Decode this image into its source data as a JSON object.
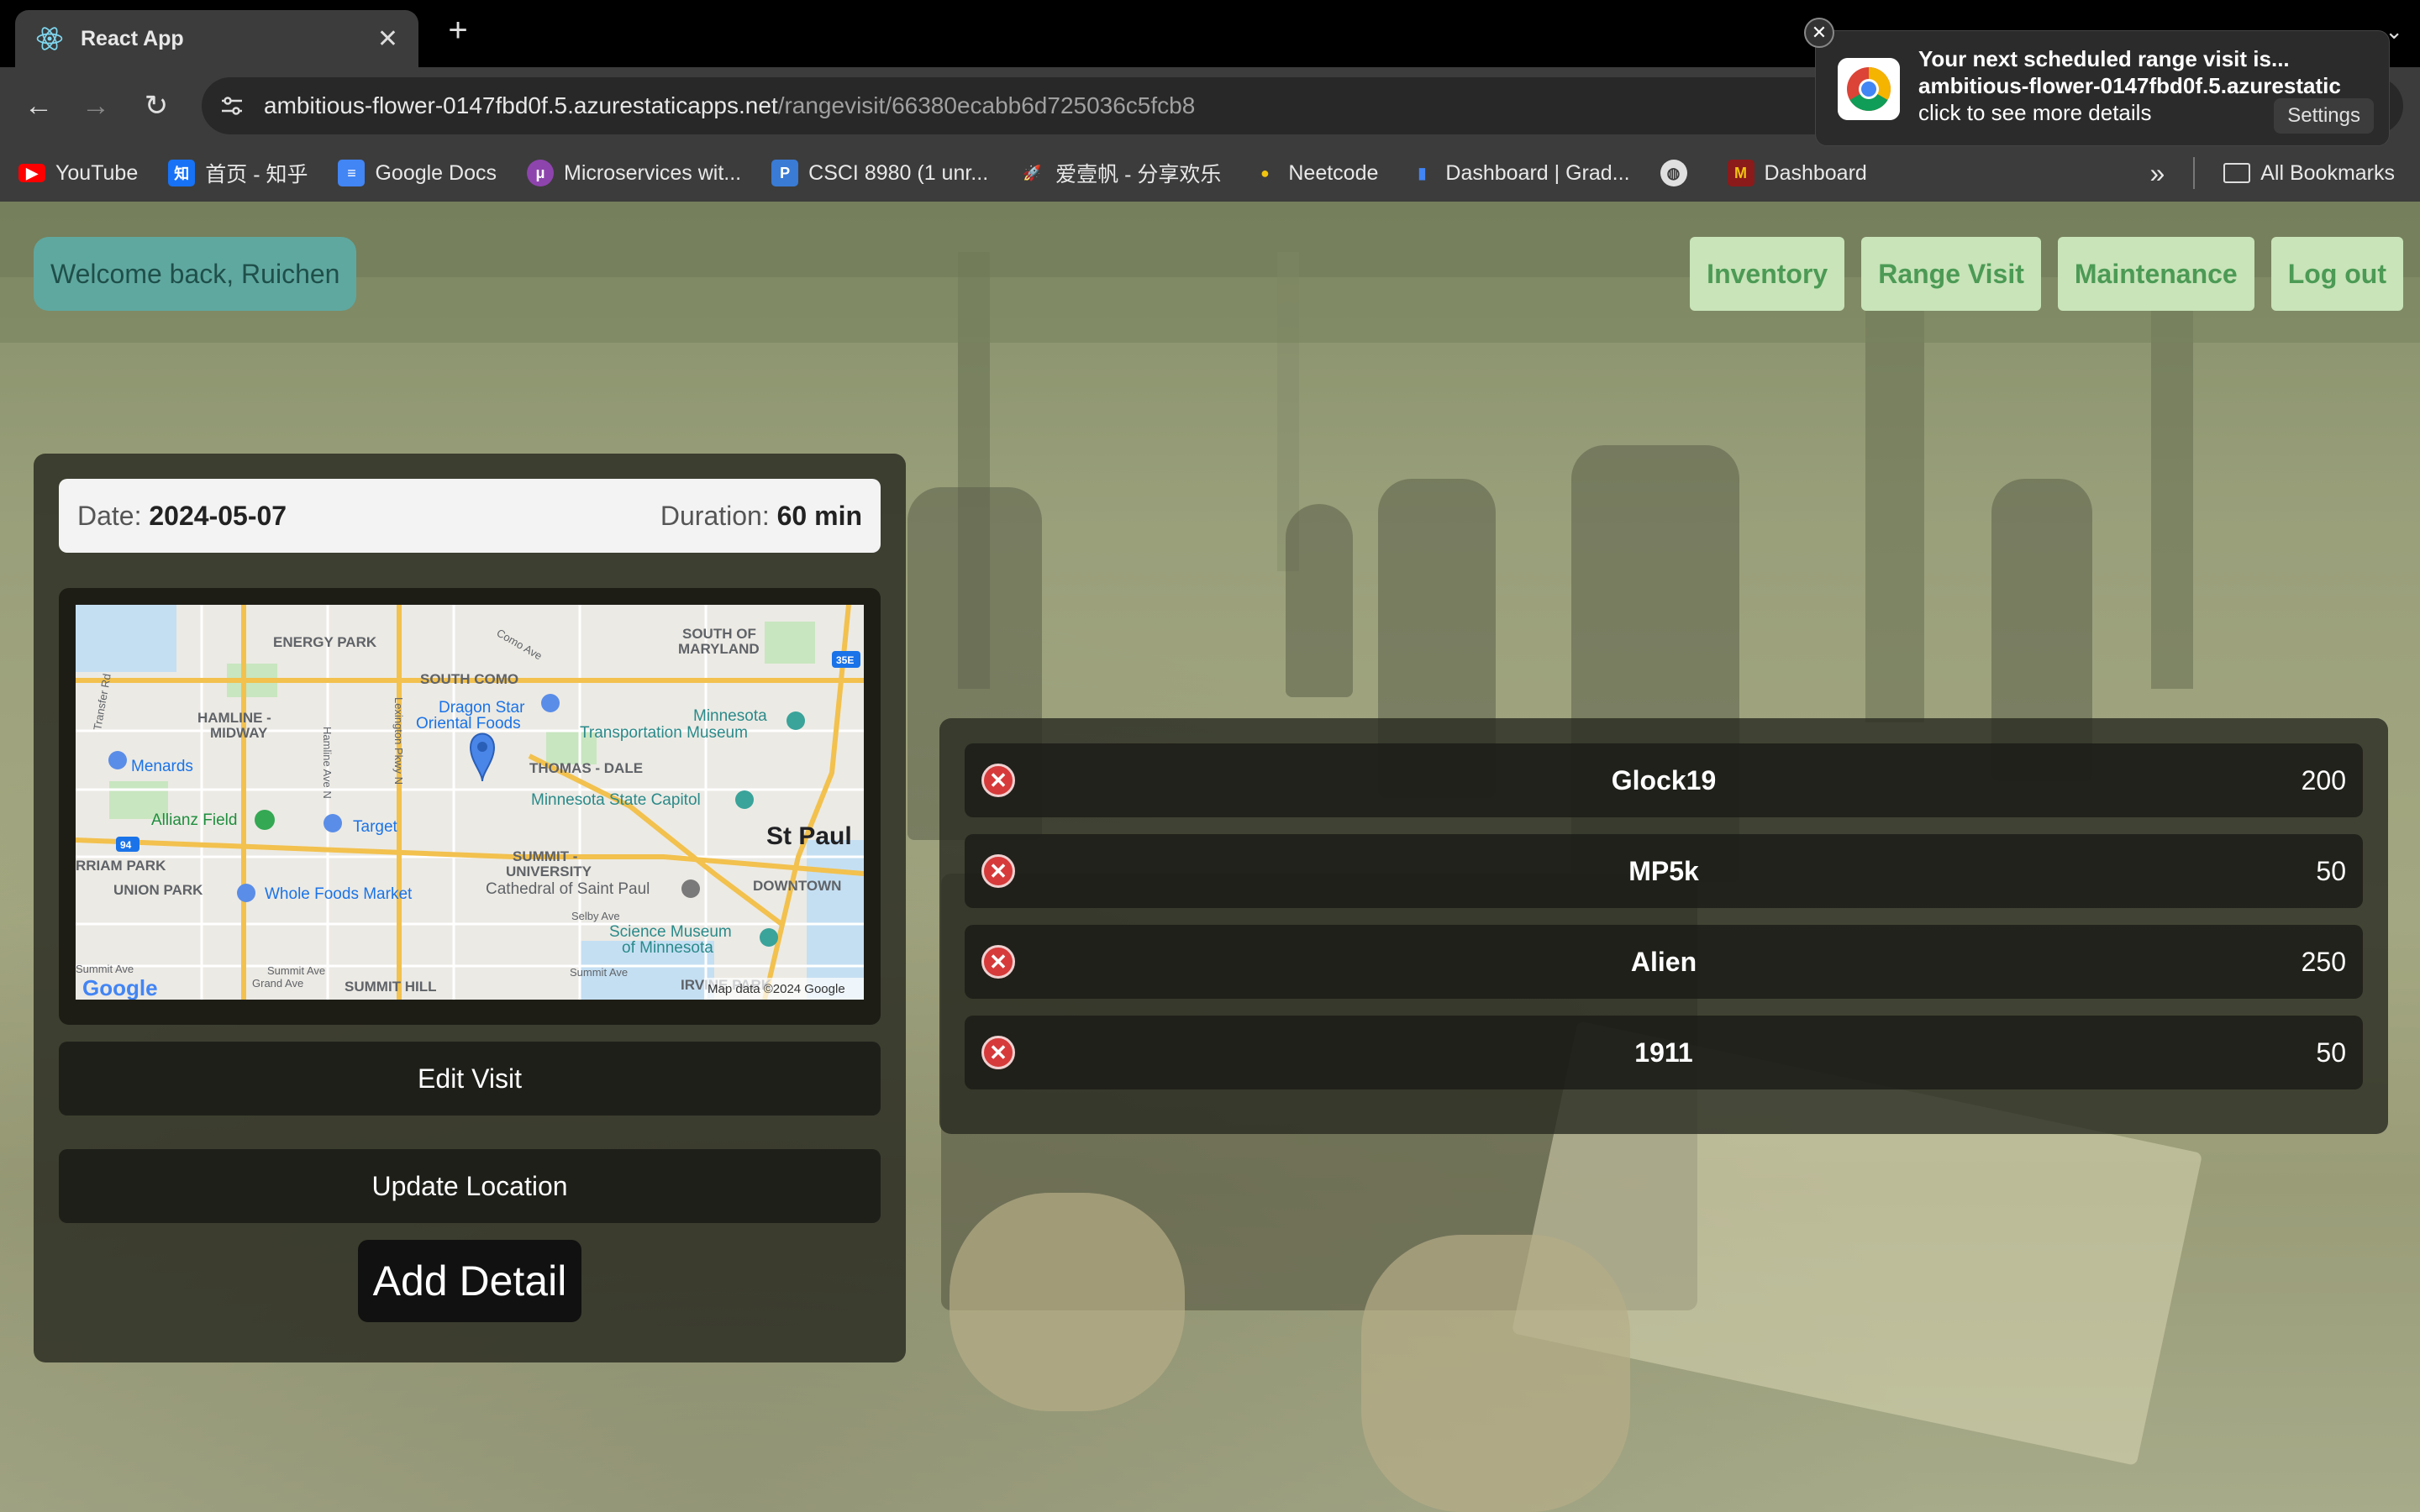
{
  "browser": {
    "tab_title": "React App",
    "url_host": "ambitious-flower-0147fbd0f.5.azurestaticapps.net",
    "url_path": "/rangevisit/66380ecabb6d725036c5fcb8",
    "bookmarks": [
      {
        "label": "YouTube",
        "icon": "youtube-icon",
        "color": "#ff0000"
      },
      {
        "label": "首页 - 知乎",
        "icon": "zhihu-icon",
        "color": "#1772f6"
      },
      {
        "label": "Google Docs",
        "icon": "google-docs-icon",
        "color": "#4285f4"
      },
      {
        "label": "Microservices wit...",
        "icon": "microservices-icon",
        "color": "#8e44ad"
      },
      {
        "label": "CSCI 8980 (1 unr...",
        "icon": "piazza-icon",
        "color": "#3a7bd5"
      },
      {
        "label": "爱壹帆 - 分享欢乐",
        "icon": "rocket-icon",
        "color": "#6a5acd"
      },
      {
        "label": "Neetcode",
        "icon": "neetcode-icon",
        "color": "#f1c40f"
      },
      {
        "label": "Dashboard | Grad...",
        "icon": "bar-chart-icon",
        "color": "#4285f4"
      },
      {
        "label": "",
        "icon": "globe-icon",
        "color": "#cccccc"
      },
      {
        "label": "Dashboard",
        "icon": "canvas-icon",
        "color": "#8b1a1a"
      }
    ],
    "all_bookmarks": "All Bookmarks"
  },
  "notification": {
    "line1": "Your next scheduled range visit is...",
    "line2": "ambitious-flower-0147fbd0f.5.azurestatic",
    "line3": "click to see more details",
    "settings_label": "Settings"
  },
  "header": {
    "welcome": "Welcome back, Ruichen",
    "nav": [
      "Inventory",
      "Range Visit",
      "Maintenance",
      "Log out"
    ]
  },
  "visit": {
    "date_label": "Date:",
    "date_value": "2024-05-07",
    "duration_label": "Duration:",
    "duration_value": "60 min",
    "edit_label": "Edit Visit",
    "update_label": "Update Location",
    "add_label": "Add Detail"
  },
  "map": {
    "labels": {
      "energy_park": "ENERGY PARK",
      "south_of_maryland": "SOUTH OF",
      "maryland": "MARYLAND",
      "south_como": "SOUTH COMO",
      "hamline": "HAMLINE -",
      "midway": "MIDWAY",
      "dragon_star": "Dragon Star",
      "oriental_foods": "Oriental Foods",
      "minnesota": "Minnesota",
      "transport_museum": "Transportation Museum",
      "menards": "Menards",
      "thomas_dale": "THOMAS - DALE",
      "state_capitol": "Minnesota State Capitol",
      "allianz": "Allianz Field",
      "target": "Target",
      "st_paul": "St Paul",
      "summit": "SUMMIT -",
      "university": "UNIVERSITY",
      "merriam_park": "RRIAM PARK",
      "union_park": "UNION PARK",
      "whole_foods": "Whole Foods Market",
      "cathedral": "Cathedral of Saint Paul",
      "downtown": "DOWNTOWN",
      "science_museum": "Science Museum",
      "of_minnesota": "of Minnesota",
      "summit_hill": "SUMMIT HILL",
      "irvine_park": "IRVINE PARK",
      "attribution": "Map data ©2024 Google",
      "google": "Google",
      "como_ave": "Como Ave",
      "transfer_rd": "Transfer Rd",
      "hamline_ave": "Hamline Ave N",
      "lexington": "Lexington Pkwy N",
      "selby": "Selby Ave",
      "summit_ave": "Summit Ave",
      "grand_ave": "Grand Ave",
      "hwy_35e": "35E",
      "hwy_94": "94"
    }
  },
  "items": [
    {
      "name": "Glock19",
      "qty": "200"
    },
    {
      "name": "MP5k",
      "qty": "50"
    },
    {
      "name": "Alien",
      "qty": "250"
    },
    {
      "name": "1911",
      "qty": "50"
    }
  ],
  "colors": {
    "welcome_bg": "#5fa8a0",
    "nav_bg": "#c8e4b8",
    "nav_text": "#4c9a55",
    "delete": "#d63a3a"
  }
}
